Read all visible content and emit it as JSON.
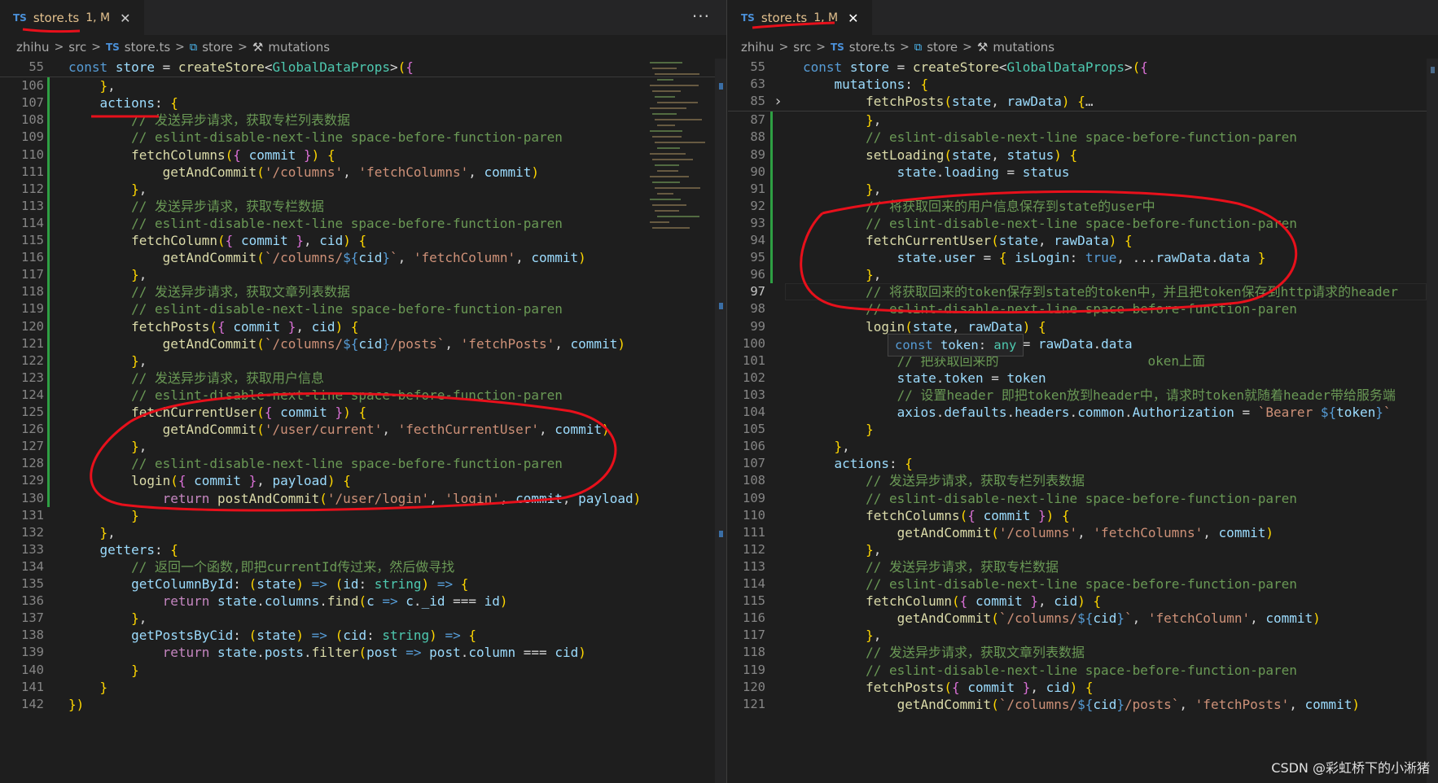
{
  "left_tab": {
    "badge": "TS",
    "name": "store.ts",
    "status": "1, M",
    "close": "✕"
  },
  "right_tab": {
    "badge": "TS",
    "name": "store.ts",
    "status": "1, M",
    "close": "✕"
  },
  "more_actions": "···",
  "breadcrumb": {
    "items": [
      "zhihu",
      "src",
      "store.ts",
      "store",
      "mutations"
    ],
    "sep": ">",
    "badge": "TS",
    "cube": "⧉",
    "wrench": "🔧"
  },
  "left_editor": {
    "sticky": {
      "ln": "55",
      "code": "const store = createStore<GlobalDataProps>({"
    },
    "lines": [
      {
        "ln": "106",
        "code": "    },"
      },
      {
        "ln": "107",
        "code": "    actions: {"
      },
      {
        "ln": "108",
        "code": "        // 发送异步请求，获取专栏列表数据"
      },
      {
        "ln": "109",
        "code": "        // eslint-disable-next-line space-before-function-paren"
      },
      {
        "ln": "110",
        "code": "        fetchColumns({ commit }) {"
      },
      {
        "ln": "111",
        "code": "            getAndCommit('/columns', 'fetchColumns', commit)"
      },
      {
        "ln": "112",
        "code": "        },"
      },
      {
        "ln": "113",
        "code": "        // 发送异步请求，获取专栏数据"
      },
      {
        "ln": "114",
        "code": "        // eslint-disable-next-line space-before-function-paren"
      },
      {
        "ln": "115",
        "code": "        fetchColumn({ commit }, cid) {"
      },
      {
        "ln": "116",
        "code": "            getAndCommit(`/columns/${cid}`, 'fetchColumn', commit)"
      },
      {
        "ln": "117",
        "code": "        },"
      },
      {
        "ln": "118",
        "code": "        // 发送异步请求，获取文章列表数据"
      },
      {
        "ln": "119",
        "code": "        // eslint-disable-next-line space-before-function-paren"
      },
      {
        "ln": "120",
        "code": "        fetchPosts({ commit }, cid) {"
      },
      {
        "ln": "121",
        "code": "            getAndCommit(`/columns/${cid}/posts`, 'fetchPosts', commit)"
      },
      {
        "ln": "122",
        "code": "        },"
      },
      {
        "ln": "123",
        "code": "        // 发送异步请求，获取用户信息"
      },
      {
        "ln": "124",
        "code": "        // eslint-disable-next-line space-before-function-paren"
      },
      {
        "ln": "125",
        "code": "        fetchCurrentUser({ commit }) {"
      },
      {
        "ln": "126",
        "code": "            getAndCommit('/user/current', 'fecthCurrentUser', commit)"
      },
      {
        "ln": "127",
        "code": "        },"
      },
      {
        "ln": "128",
        "code": "        // eslint-disable-next-line space-before-function-paren"
      },
      {
        "ln": "129",
        "code": "        login({ commit }, payload) {"
      },
      {
        "ln": "130",
        "code": "            return postAndCommit('/user/login', 'login', commit, payload)"
      },
      {
        "ln": "131",
        "code": "        }"
      },
      {
        "ln": "132",
        "code": "    },"
      },
      {
        "ln": "133",
        "code": "    getters: {"
      },
      {
        "ln": "134",
        "code": "        // 返回一个函数,即把currentId传过来，然后做寻找"
      },
      {
        "ln": "135",
        "code": "        getColumnById: (state) => (id: string) => {"
      },
      {
        "ln": "136",
        "code": "            return state.columns.find(c => c._id === id)"
      },
      {
        "ln": "137",
        "code": "        },"
      },
      {
        "ln": "138",
        "code": "        getPostsByCid: (state) => (cid: string) => {"
      },
      {
        "ln": "139",
        "code": "            return state.posts.filter(post => post.column === cid)"
      },
      {
        "ln": "140",
        "code": "        }"
      },
      {
        "ln": "141",
        "code": "    }"
      },
      {
        "ln": "142",
        "code": "})"
      }
    ]
  },
  "right_editor": {
    "sticky": [
      {
        "ln": "55",
        "code": "const store = createStore<GlobalDataProps>({"
      },
      {
        "ln": "63",
        "code": "    mutations: {"
      },
      {
        "ln": "85",
        "code": "        fetchPosts(state, rawData) {…"
      }
    ],
    "lines": [
      {
        "ln": "87",
        "code": "        },"
      },
      {
        "ln": "88",
        "code": "        // eslint-disable-next-line space-before-function-paren"
      },
      {
        "ln": "89",
        "code": "        setLoading(state, status) {"
      },
      {
        "ln": "90",
        "code": "            state.loading = status"
      },
      {
        "ln": "91",
        "code": "        },"
      },
      {
        "ln": "92",
        "code": "        // 将获取回来的用户信息保存到state的user中"
      },
      {
        "ln": "93",
        "code": "        // eslint-disable-next-line space-before-function-paren"
      },
      {
        "ln": "94",
        "code": "        fetchCurrentUser(state, rawData) {"
      },
      {
        "ln": "95",
        "code": "            state.user = { isLogin: true, ...rawData.data }"
      },
      {
        "ln": "96",
        "code": "        },"
      },
      {
        "ln": "97",
        "code": "        // 将获取回来的token保存到state的token中，并且把token保存到http请求的header"
      },
      {
        "ln": "98",
        "code": "        // eslint-disable-next-line space-before-function-paren"
      },
      {
        "ln": "99",
        "code": "        login(state, rawData) {"
      },
      {
        "ln": "100",
        "code": "            const { token } = rawData.data"
      },
      {
        "ln": "101",
        "code": "            // 把获取回来的                   oken上面"
      },
      {
        "ln": "102",
        "code": "            state.token = token"
      },
      {
        "ln": "103",
        "code": "            // 设置header 即把token放到header中，请求时token就随着header带给服务端"
      },
      {
        "ln": "104",
        "code": "            axios.defaults.headers.common.Authorization = `Bearer ${token}`"
      },
      {
        "ln": "105",
        "code": "        }"
      },
      {
        "ln": "106",
        "code": "    },"
      },
      {
        "ln": "107",
        "code": "    actions: {"
      },
      {
        "ln": "108",
        "code": "        // 发送异步请求，获取专栏列表数据"
      },
      {
        "ln": "109",
        "code": "        // eslint-disable-next-line space-before-function-paren"
      },
      {
        "ln": "110",
        "code": "        fetchColumns({ commit }) {"
      },
      {
        "ln": "111",
        "code": "            getAndCommit('/columns', 'fetchColumns', commit)"
      },
      {
        "ln": "112",
        "code": "        },"
      },
      {
        "ln": "113",
        "code": "        // 发送异步请求，获取专栏数据"
      },
      {
        "ln": "114",
        "code": "        // eslint-disable-next-line space-before-function-paren"
      },
      {
        "ln": "115",
        "code": "        fetchColumn({ commit }, cid) {"
      },
      {
        "ln": "116",
        "code": "            getAndCommit(`/columns/${cid}`, 'fetchColumn', commit)"
      },
      {
        "ln": "117",
        "code": "        },"
      },
      {
        "ln": "118",
        "code": "        // 发送异步请求，获取文章列表数据"
      },
      {
        "ln": "119",
        "code": "        // eslint-disable-next-line space-before-function-paren"
      },
      {
        "ln": "120",
        "code": "        fetchPosts({ commit }, cid) {"
      },
      {
        "ln": "121",
        "code": "            getAndCommit(`/columns/${cid}/posts`, 'fetchPosts', commit)"
      }
    ],
    "current_line": "97"
  },
  "hover_tooltip": "const token: any",
  "watermark": "CSDN @彩虹桥下的小淅猪",
  "colors": {
    "comment": "#6a9955",
    "keyword": "#569cd6",
    "string": "#ce9178",
    "function": "#dcdcaa",
    "variable": "#9cdcfe",
    "type": "#4ec9b0",
    "annotation": "#e8101b",
    "modified": "#e2c08d"
  }
}
